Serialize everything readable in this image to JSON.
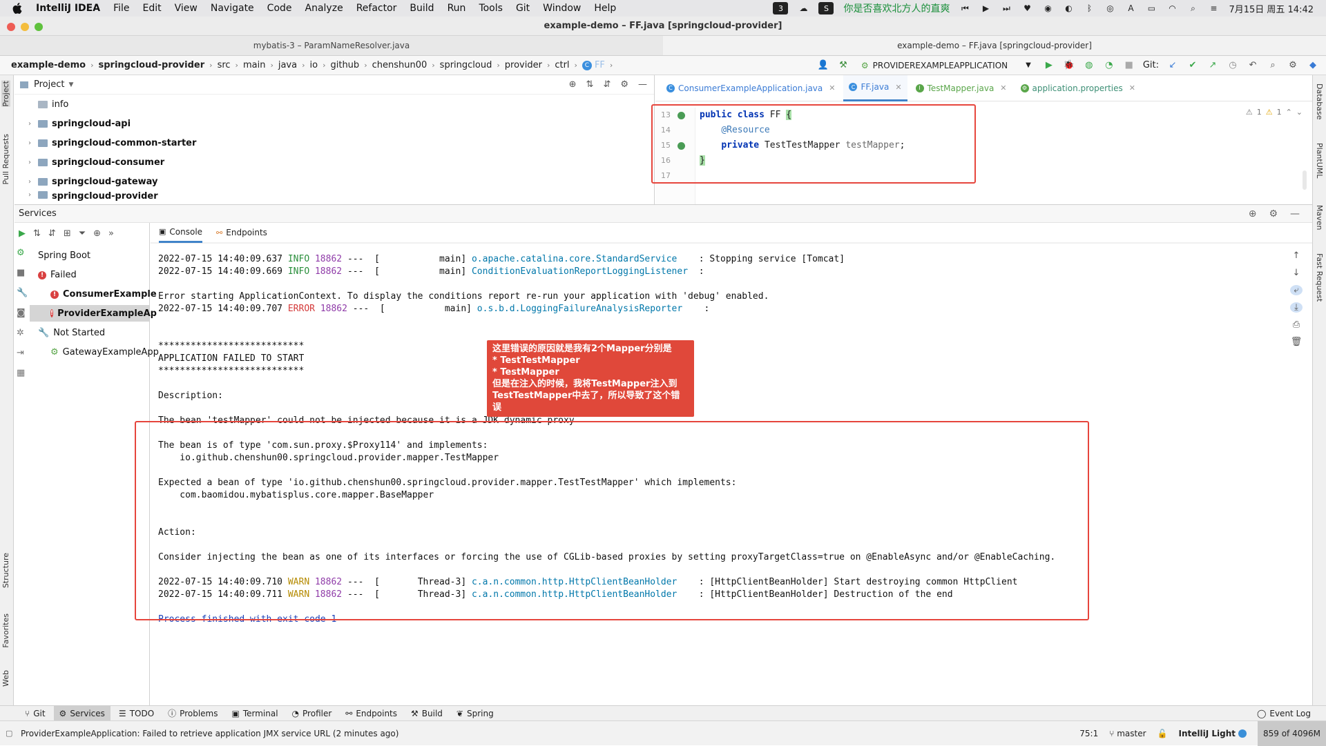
{
  "menubar": {
    "items": [
      "IntelliJ IDEA",
      "File",
      "Edit",
      "View",
      "Navigate",
      "Code",
      "Analyze",
      "Refactor",
      "Build",
      "Run",
      "Tools",
      "Git",
      "Window",
      "Help"
    ],
    "badge_text": "3",
    "song": "你是否喜欢北方人的直爽",
    "datetime": "7月15日 周五  14:42"
  },
  "window": {
    "title": "example-demo – FF.java [springcloud-provider]",
    "tabs": [
      "mybatis-3 – ParamNameResolver.java",
      "example-demo – FF.java [springcloud-provider]"
    ]
  },
  "breadcrumb": [
    "example-demo",
    "springcloud-provider",
    "src",
    "main",
    "java",
    "io",
    "github",
    "chenshun00",
    "springcloud",
    "provider",
    "ctrl",
    "FF"
  ],
  "toolbar": {
    "run_config": "PROVIDEREXAMPLEAPPLICATION",
    "git_label": "Git:"
  },
  "project": {
    "title": "Project",
    "items": [
      {
        "label": "info",
        "bold": false,
        "expandable": false
      },
      {
        "label": "springcloud-api",
        "bold": true,
        "expandable": true
      },
      {
        "label": "springcloud-common-starter",
        "bold": true,
        "expandable": true
      },
      {
        "label": "springcloud-consumer",
        "bold": true,
        "expandable": true
      },
      {
        "label": "springcloud-gateway",
        "bold": true,
        "expandable": true
      },
      {
        "label": "springcloud-provider",
        "bold": true,
        "expandable": true
      }
    ]
  },
  "editor": {
    "tabs": [
      {
        "label": "ConsumerExampleApplication.java",
        "color": "#3a7bd5",
        "icon": "C",
        "active": false
      },
      {
        "label": "FF.java",
        "color": "#3a7bd5",
        "icon": "C",
        "active": true
      },
      {
        "label": "TestMapper.java",
        "color": "#5aa64a",
        "icon": "I",
        "active": false
      },
      {
        "label": "application.properties",
        "color": "#3d8f75",
        "icon": "P",
        "active": false
      }
    ],
    "line_numbers": [
      "13",
      "14",
      "15",
      "16",
      "17"
    ],
    "code": {
      "l13_kw1": "public",
      "l13_kw2": "class",
      "l13_name": "FF",
      "l13_brace": "{",
      "l14_ann": "@Resource",
      "l15_kw": "private",
      "l15_type": "TestTestMapper",
      "l15_field": "testMapper",
      "l15_semi": ";",
      "l16_brace": "}"
    },
    "inspections": {
      "weak": "1",
      "warn": "1"
    }
  },
  "services": {
    "title": "Services",
    "tree": {
      "spring_boot": "Spring Boot",
      "failed": "Failed",
      "consumer": "ConsumerExample",
      "provider": "ProviderExampleAp",
      "not_started": "Not Started",
      "gateway": "GatewayExampleApp"
    },
    "tabs": [
      "Console",
      "Endpoints"
    ]
  },
  "console": {
    "lines": [
      {
        "ts": "2022-07-15 14:40:09.637",
        "level": "INFO",
        "pid": "18862",
        "thread": "---  [           main]",
        "cls": "o.apache.catalina.core.StandardService   ",
        "msg": ": Stopping service [Tomcat]"
      },
      {
        "ts": "2022-07-15 14:40:09.669",
        "level": "INFO",
        "pid": "18862",
        "thread": "---  [           main]",
        "cls": "ConditionEvaluationReportLoggingListener ",
        "msg": ":"
      },
      {
        "plain": ""
      },
      {
        "plain": "Error starting ApplicationContext. To display the conditions report re-run your application with 'debug' enabled."
      },
      {
        "ts": "2022-07-15 14:40:09.707",
        "level": "ERROR",
        "pid": "18862",
        "thread": "---  [           main]",
        "cls": "o.s.b.d.LoggingFailureAnalysisReporter   ",
        "msg": ":"
      },
      {
        "plain": ""
      },
      {
        "plain": ""
      },
      {
        "plain": "***************************"
      },
      {
        "plain": "APPLICATION FAILED TO START"
      },
      {
        "plain": "***************************"
      },
      {
        "plain": ""
      },
      {
        "plain": "Description:"
      },
      {
        "plain": ""
      },
      {
        "plain": "The bean 'testMapper' could not be injected because it is a JDK dynamic proxy"
      },
      {
        "plain": ""
      },
      {
        "plain": "The bean is of type 'com.sun.proxy.$Proxy114' and implements:"
      },
      {
        "plain": "    io.github.chenshun00.springcloud.provider.mapper.TestMapper"
      },
      {
        "plain": ""
      },
      {
        "plain": "Expected a bean of type 'io.github.chenshun00.springcloud.provider.mapper.TestTestMapper' which implements:"
      },
      {
        "plain": "    com.baomidou.mybatisplus.core.mapper.BaseMapper"
      },
      {
        "plain": ""
      },
      {
        "plain": ""
      },
      {
        "plain": "Action:"
      },
      {
        "plain": ""
      },
      {
        "plain": "Consider injecting the bean as one of its interfaces or forcing the use of CGLib-based proxies by setting proxyTargetClass=true on @EnableAsync and/or @EnableCaching."
      },
      {
        "plain": ""
      },
      {
        "ts": "2022-07-15 14:40:09.710",
        "level": "WARN",
        "pid": "18862",
        "thread": "---  [       Thread-3]",
        "cls": "c.a.n.common.http.HttpClientBeanHolder   ",
        "msg": ": [HttpClientBeanHolder] Start destroying common HttpClient"
      },
      {
        "ts": "2022-07-15 14:40:09.711",
        "level": "WARN",
        "pid": "18862",
        "thread": "---  [       Thread-3]",
        "cls": "c.a.n.common.http.HttpClientBeanHolder   ",
        "msg": ": [HttpClientBeanHolder] Destruction of the end"
      },
      {
        "plain": ""
      },
      {
        "proc": "Process finished with exit code 1"
      }
    ]
  },
  "callout": {
    "lines": [
      "这里错误的原因就是我有2个Mapper分别是",
      "* TestTestMapper",
      "* TestMapper",
      "但是在注入的时候，我将TestMapper注入到TestTestMapper中去了，所以导致了这个错误"
    ]
  },
  "left_strip": {
    "project": "Project",
    "pull": "Pull Requests",
    "structure": "Structure",
    "favorites": "Favorites",
    "web": "Web"
  },
  "right_strip": {
    "database": "Database",
    "plantuml": "PlantUML",
    "maven": "Maven",
    "fast": "Fast Request"
  },
  "bottom_tools": [
    "Git",
    "Services",
    "TODO",
    "Problems",
    "Terminal",
    "Profiler",
    "Endpoints",
    "Build",
    "Spring"
  ],
  "event_log": "Event Log",
  "status": {
    "message": "ProviderExampleApplication: Failed to retrieve application JMX service URL (2 minutes ago)",
    "position": "75:1",
    "branch": "master",
    "theme": "IntelliJ Light",
    "memory": "859 of 4096M"
  },
  "colors": {
    "accent": "#4083c9",
    "error": "#d94040",
    "annotation": "#e6453c"
  }
}
